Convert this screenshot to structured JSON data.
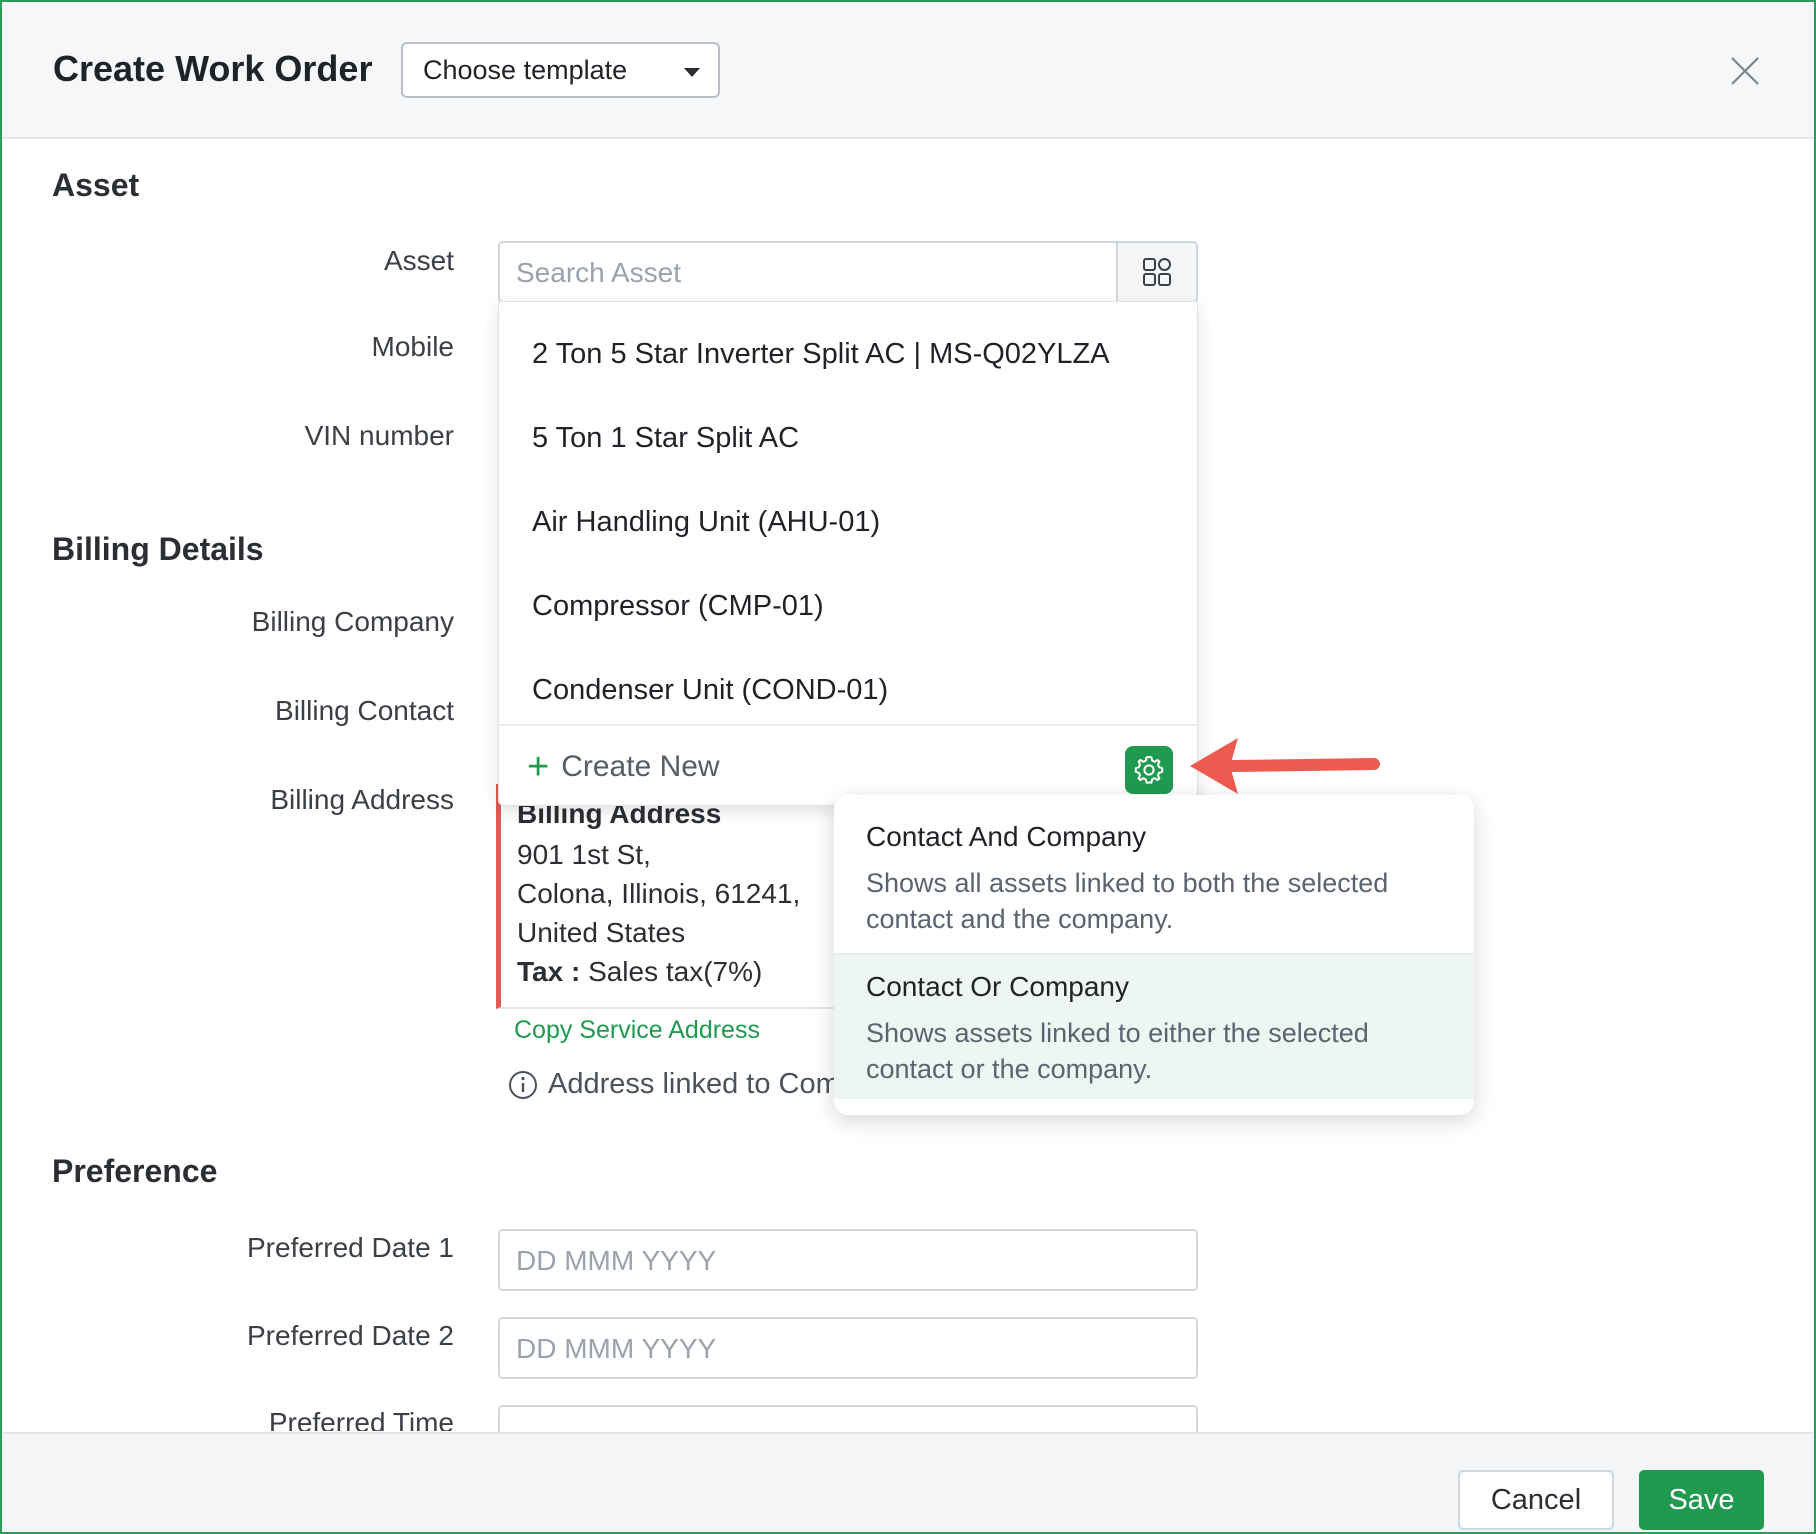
{
  "header": {
    "title": "Create Work Order",
    "template_select": "Choose template"
  },
  "sections": {
    "asset": "Asset",
    "billing": "Billing Details",
    "preference": "Preference"
  },
  "labels": {
    "asset": "Asset",
    "mobile": "Mobile",
    "vin": "VIN number",
    "billing_company": "Billing Company",
    "billing_contact": "Billing Contact",
    "billing_address": "Billing Address",
    "pref_date1": "Preferred Date 1",
    "pref_date2": "Preferred Date 2",
    "pref_time": "Preferred Time"
  },
  "asset_search": {
    "placeholder": "Search Asset"
  },
  "asset_dropdown": {
    "items": [
      "2 Ton 5 Star Inverter Split AC | MS-Q02YLZA",
      "5 Ton 1 Star Split AC",
      "Air Handling Unit (AHU-01)",
      "Compressor (CMP-01)",
      "Condenser Unit (COND-01)"
    ],
    "create_new": "Create New"
  },
  "billing_address_card": {
    "title": "Billing Address",
    "line1": "901 1st St,",
    "line2": "Colona, Illinois, 61241,",
    "line3": "United States",
    "tax_label": "Tax :",
    "tax_value": "Sales tax(7%)"
  },
  "copy_service_address": "Copy Service Address",
  "address_note": "Address linked to Com",
  "filter_popover": {
    "options": [
      {
        "title": "Contact And Company",
        "desc": "Shows all assets linked to both the selected contact and the company."
      },
      {
        "title": "Contact Or Company",
        "desc": "Shows assets linked to either the selected contact or the company."
      }
    ]
  },
  "date_placeholder": "DD MMM YYYY",
  "footer": {
    "cancel": "Cancel",
    "save": "Save"
  },
  "colors": {
    "accent": "#1f9a4f",
    "arrow": "#ec5a50",
    "address_border": "#e25b52"
  }
}
